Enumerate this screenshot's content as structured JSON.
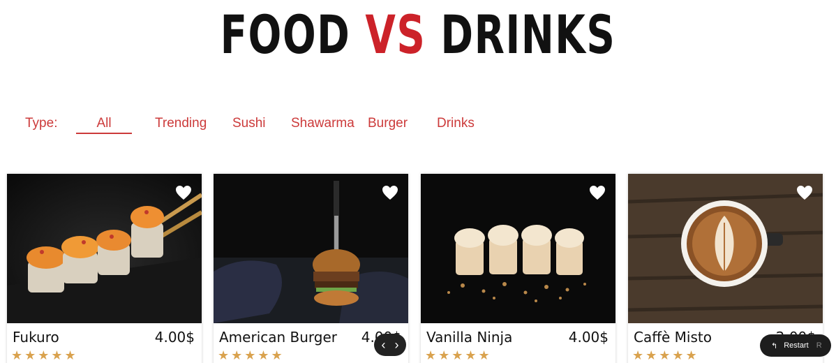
{
  "header": {
    "title_part1": "FOOD ",
    "title_vs": "VS",
    "title_part2": " DRINKS"
  },
  "filters": {
    "label": "Type:",
    "items": [
      "All",
      "Trending",
      "Sushi",
      "Shawarma",
      "Burger",
      "Drinks"
    ],
    "active": "All"
  },
  "products": [
    {
      "name": "Fukuro",
      "price": "4.00$",
      "rating": 5,
      "stars": "★★★★★",
      "image": "sushi-rolls-chopsticks"
    },
    {
      "name": "American Burger",
      "price": "4.00$",
      "rating": 5,
      "stars": "★★★★★",
      "image": "burger-with-knife"
    },
    {
      "name": "Vanilla Ninja",
      "price": "4.00$",
      "rating": 5,
      "stars": "★★★★★",
      "image": "cream-topped-sushi"
    },
    {
      "name": "Caffè Misto",
      "price": "2.00$",
      "rating": 5,
      "stars": "★★★★★",
      "image": "latte-art-coffee"
    }
  ],
  "controls": {
    "prev": "‹",
    "next": "›",
    "restart_label": "Restart",
    "restart_icon": "↰",
    "restart_key": "R"
  },
  "colors": {
    "accent": "#cc2229",
    "filter_text": "#cc3a3a",
    "star": "#d9a24e"
  }
}
